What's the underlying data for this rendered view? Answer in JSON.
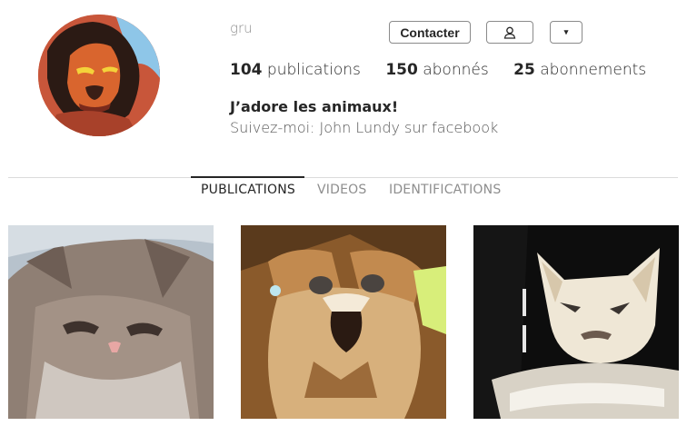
{
  "profile": {
    "username": "gru",
    "contact_label": "Contacter",
    "more_label": "▾",
    "stats": [
      {
        "count": "104",
        "label": "publications"
      },
      {
        "count": "150",
        "label": "abonnés"
      },
      {
        "count": "25",
        "label": "abonnements"
      }
    ],
    "bio_title": "J’adore les animaux!",
    "bio_line": "Suivez-moi: John Lundy sur facebook"
  },
  "tabs": [
    {
      "label": "PUBLICATIONS",
      "active": true
    },
    {
      "label": "VIDEOS",
      "active": false
    },
    {
      "label": "IDENTIFICATIONS",
      "active": false
    }
  ],
  "icons": {
    "follow": "person-icon",
    "more": "chevron-down-icon"
  },
  "colors": {
    "text": "#262626",
    "muted": "#8e8e8e",
    "divider": "#dbdbdb"
  }
}
